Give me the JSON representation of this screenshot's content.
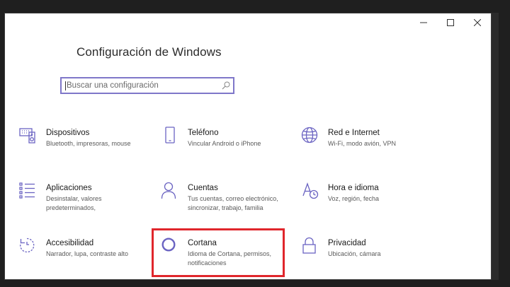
{
  "window": {
    "controls": [
      "minimize",
      "maximize",
      "close"
    ]
  },
  "page_title": "Configuración de Windows",
  "search": {
    "placeholder": "Buscar una configuración"
  },
  "tiles": [
    {
      "name": "Dispositivos",
      "desc": [
        "Bluetooth, impresoras, mouse"
      ],
      "icon": "keyboard-speaker-icon"
    },
    {
      "name": "Teléfono",
      "desc": [
        "Vincular Android o iPhone"
      ],
      "icon": "phone-icon"
    },
    {
      "name": "Red e Internet",
      "desc": [
        "Wi-Fi, modo avión, VPN"
      ],
      "icon": "globe-icon"
    },
    {
      "name": "Aplicaciones",
      "desc": [
        "Desinstalar, valores",
        "predeterminados,"
      ],
      "icon": "apps-list-icon"
    },
    {
      "name": "Cuentas",
      "desc": [
        "Tus cuentas, correo electrónico,",
        "sincronizar, trabajo, familia"
      ],
      "icon": "person-icon"
    },
    {
      "name": "Hora e idioma",
      "desc": [
        "Voz, región, fecha"
      ],
      "icon": "time-language-icon"
    },
    {
      "name": "Accesibilidad",
      "desc": [
        "Narrador, lupa, contraste alto"
      ],
      "icon": "ease-of-access-icon"
    },
    {
      "name": "Cortana",
      "desc": [
        "Idioma de Cortana, permisos,",
        "notificaciones"
      ],
      "icon": "cortana-circle-icon"
    },
    {
      "name": "Privacidad",
      "desc": [
        "Ubicación, cámara"
      ],
      "icon": "lock-icon"
    }
  ],
  "accent_color": "#6b64c2",
  "highlight_color": "#e0262c"
}
